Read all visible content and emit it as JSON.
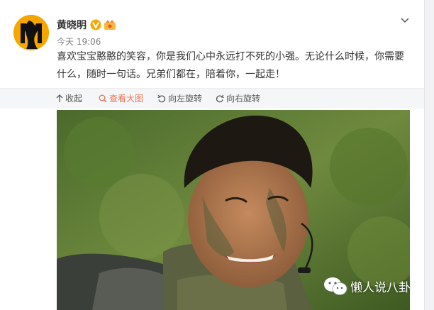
{
  "user": {
    "name": "黄晓明",
    "time": "今天 19:06"
  },
  "post": {
    "text": "喜欢宝宝憨憨的笑容，你是我们心中永远打不死的小强。无论什么时候，你需要什么，随时一句话。兄弟们都在，陪着你，一起走！"
  },
  "toolbar": {
    "collapse": "收起",
    "view_large": "查看大图",
    "rotate_left": "向左旋转",
    "rotate_right": "向右旋转"
  },
  "watermark": {
    "text": "懒人说八卦"
  },
  "colors": {
    "verified": "#f5a700",
    "active_tool": "#eb7350"
  },
  "icons": [
    "chevron-down-icon",
    "verified-icon",
    "member-icon",
    "arrow-up-icon",
    "search-icon",
    "rotate-left-icon",
    "rotate-right-icon",
    "wechat-icon"
  ]
}
